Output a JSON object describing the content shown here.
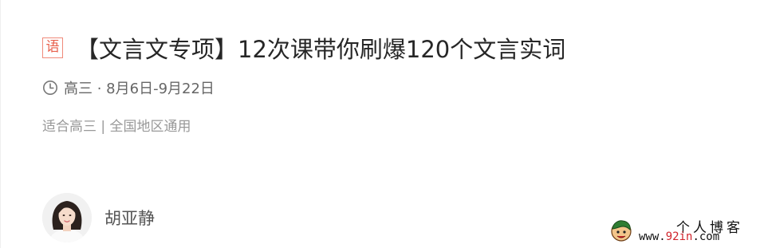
{
  "course": {
    "subject_tag": "语",
    "title": "【文言文专项】12次课带你刷爆120个文言实词",
    "schedule": "高三 · 8月6日-9月22日",
    "tags": "适合高三 | 全国地区通用"
  },
  "teacher": {
    "name": "胡亚静"
  },
  "watermark": {
    "title": "个人博客",
    "url_prefix": "www.",
    "url_accent": "92in",
    "url_suffix": ".com"
  },
  "colors": {
    "subject_tag": "#e8604c",
    "title": "#262626",
    "meta": "#666666",
    "tags": "#999999"
  },
  "icons": {
    "schedule": "clock-icon",
    "watermark": "cartoon-logo-icon"
  }
}
